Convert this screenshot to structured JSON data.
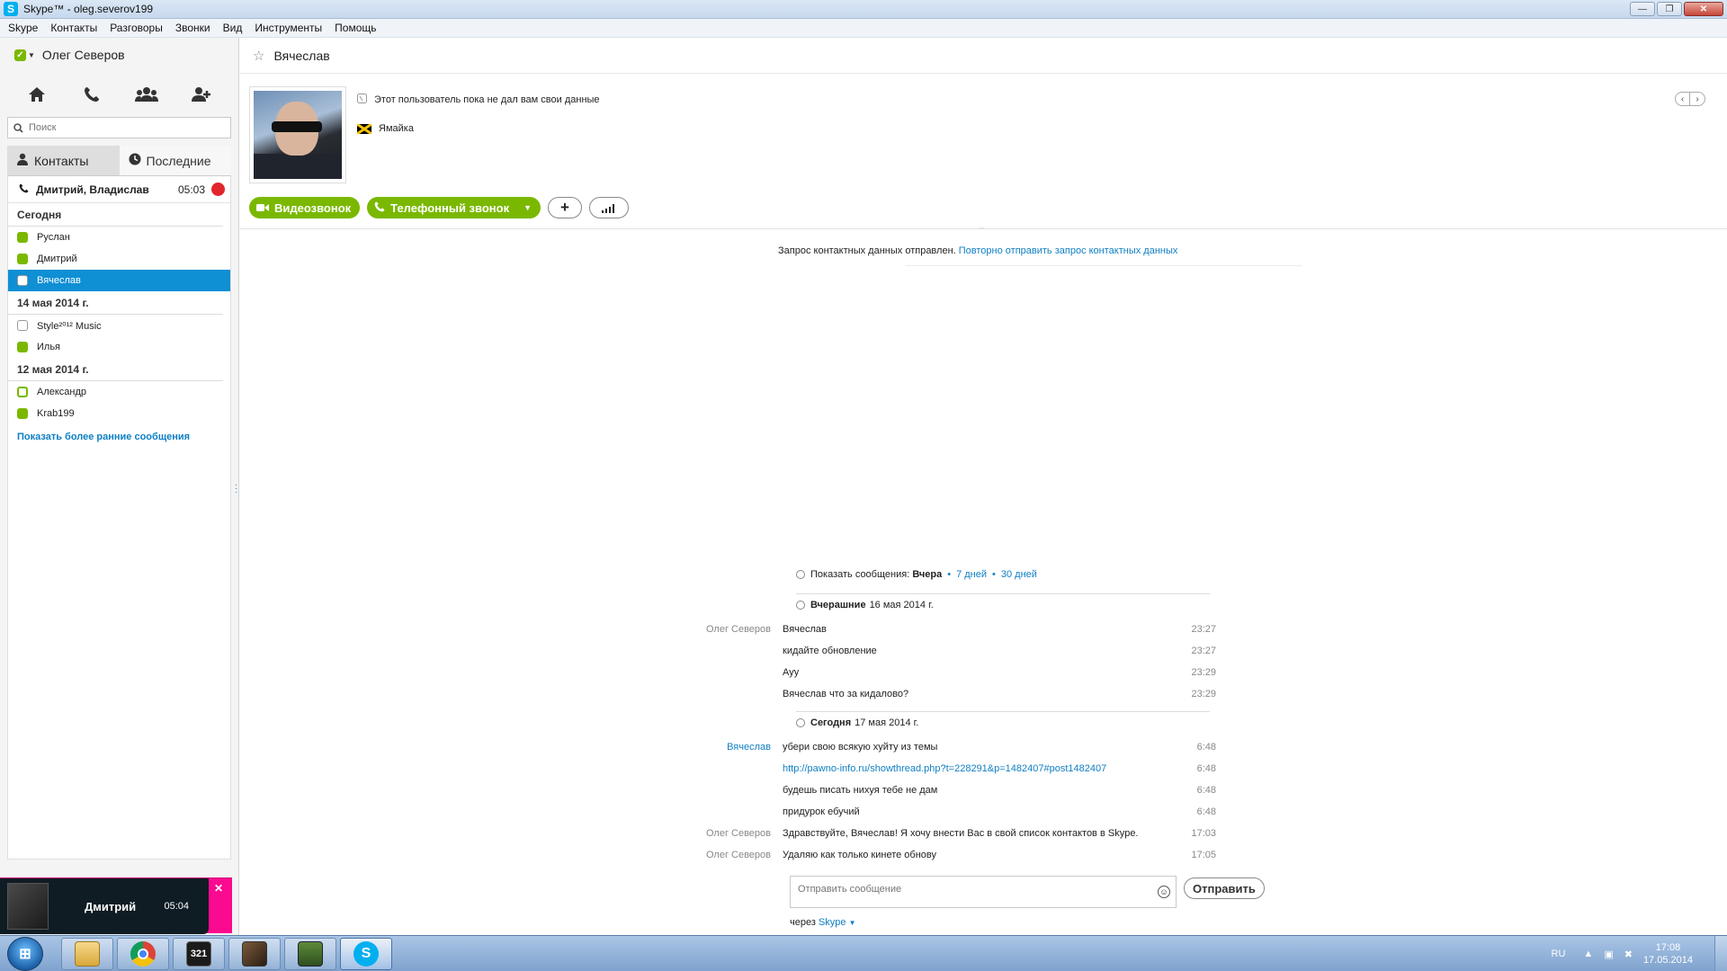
{
  "window": {
    "title": "Skype™ - oleg.severov199",
    "controls": {
      "minimize": "—",
      "maximize": "❐",
      "close": "✕"
    }
  },
  "menu": [
    "Skype",
    "Контакты",
    "Разговоры",
    "Звонки",
    "Вид",
    "Инструменты",
    "Помощь"
  ],
  "profile": {
    "name": "Олег Северов",
    "status": "online"
  },
  "search": {
    "placeholder": "Поиск"
  },
  "tabs": [
    {
      "label": "Контакты",
      "icon": "person-icon",
      "active": true
    },
    {
      "label": "Последние",
      "icon": "clock-icon",
      "active": false
    }
  ],
  "active_call": {
    "names": "Дмитрий, Владислав",
    "time": "05:03"
  },
  "recent_groups": [
    {
      "header": "Сегодня",
      "contacts": [
        {
          "name": "Руслан",
          "status": "online"
        },
        {
          "name": "Дмитрий",
          "status": "online"
        },
        {
          "name": "Вячеслав",
          "status": "pending",
          "selected": true
        }
      ]
    },
    {
      "header": "14 мая 2014 г.",
      "contacts": [
        {
          "name": "Style²⁰¹² Music",
          "status": "pending"
        },
        {
          "name": "Илья",
          "status": "online"
        }
      ]
    },
    {
      "header": "12 мая 2014 г.",
      "contacts": [
        {
          "name": "Александр",
          "status": "offline"
        },
        {
          "name": "Krab199",
          "status": "online"
        }
      ]
    }
  ],
  "show_earlier": "Показать более ранние сообщения",
  "call_popup": {
    "name": "Дмитрий",
    "time": "05:04",
    "close": "✕"
  },
  "conversation": {
    "contact_name": "Вячеслав",
    "info_text": "Этот пользователь пока не дал вам свои данные",
    "country": "Ямайка",
    "video_call": "Видеозвонок",
    "phone_call": "Телефонный звонок",
    "add_button": "+",
    "divider_dots": "...",
    "request_sent": "Запрос контактных данных отправлен.",
    "request_resend": "Повторно отправить запрос контактных данных"
  },
  "history_filter": {
    "label": "Показать сообщения:",
    "current": "Вчера",
    "opt_7": "7 дней",
    "opt_30": "30 дней",
    "dot": "•"
  },
  "days": [
    {
      "label": "Вчерашние",
      "date": "16 мая 2014 г."
    },
    {
      "label": "Сегодня",
      "date": "17 мая 2014 г."
    }
  ],
  "messages": [
    {
      "author": "Олег Северов",
      "text": "Вячеслав",
      "time": "23:27",
      "mine": true
    },
    {
      "author": "",
      "text": "кидайте обновление",
      "time": "23:27",
      "mine": true
    },
    {
      "author": "",
      "text": "Ауу",
      "time": "23:29",
      "mine": true
    },
    {
      "author": "",
      "text": "Вячеслав что за кидалово?",
      "time": "23:29",
      "mine": true
    },
    {
      "author": "Вячеслав",
      "text": "убери свою всякую хуйту из темы",
      "time": "6:48",
      "mine": false
    },
    {
      "author": "",
      "text": "http://pawno-info.ru/showthread.php?t=228291&p=1482407#post1482407",
      "time": "6:48",
      "mine": false,
      "link": true
    },
    {
      "author": "",
      "text": "будешь писать нихуя тебе не дам",
      "time": "6:48",
      "mine": false
    },
    {
      "author": "",
      "text": "придурок ебучий",
      "time": "6:48",
      "mine": false
    },
    {
      "author": "Олег Северов",
      "text": "Здравствуйте, Вячеслав! Я хочу внести Вас в свой список контактов в Skype.",
      "time": "17:03",
      "mine": true
    },
    {
      "author": "Олег Северов",
      "text": "Удаляю как только кинете обнову",
      "time": "17:05",
      "mine": true
    }
  ],
  "compose": {
    "placeholder": "Отправить сообщение",
    "send": "Отправить",
    "via_label": "через",
    "via_value": "Skype"
  },
  "taskbar": {
    "apps": [
      {
        "name": "explorer",
        "icon": "folder-icon"
      },
      {
        "name": "chrome",
        "icon": "chrome-icon"
      },
      {
        "name": "media-player",
        "icon": "media-classic-icon",
        "label": "321"
      },
      {
        "name": "game",
        "icon": "game-icon"
      },
      {
        "name": "app",
        "icon": "window-app-icon"
      },
      {
        "name": "skype",
        "icon": "skype-icon",
        "active": true,
        "label": "S"
      }
    ],
    "lang": "RU",
    "time": "17:08",
    "date": "17.05.2014"
  },
  "colors": {
    "accent": "#0f8fd4",
    "green": "#7ab800",
    "link": "#0f7fc4",
    "popup_pink": "#fa0a8f"
  }
}
